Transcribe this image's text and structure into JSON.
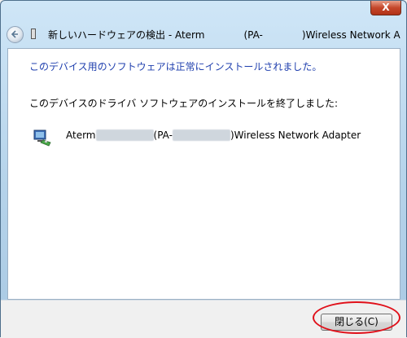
{
  "window": {
    "close_glyph": "X",
    "title": "新しいハードウェアの検出 - Aterm    (PA-    )Wireless Network A"
  },
  "content": {
    "heading": "このデバイス用のソフトウェアは正常にインストールされました。",
    "description": "このデバイスのドライバ ソフトウェアのインストールを終了しました:",
    "device": {
      "prefix": "Aterm",
      "middle": "(PA-",
      "suffix": ")Wireless Network Adapter",
      "icon": "network-adapter-icon"
    }
  },
  "footer": {
    "close_button_label": "閉じる(C)"
  },
  "colors": {
    "heading": "#1f3fae",
    "highlight": "#e0101a"
  }
}
